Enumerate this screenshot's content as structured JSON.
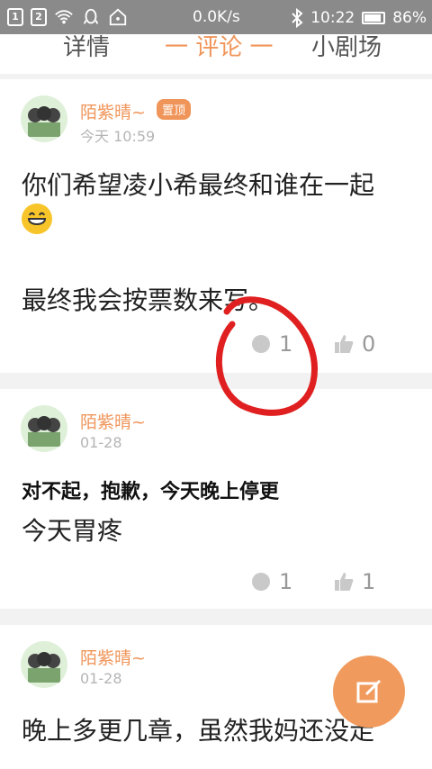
{
  "status_bar": {
    "sim1": "1",
    "sim2": "2",
    "speed": "0.0K/s",
    "time": "10:22",
    "battery": "86%"
  },
  "tabs": [
    {
      "label": "详情"
    },
    {
      "label": "一 评论 一"
    },
    {
      "label": "小剧场"
    }
  ],
  "posts": [
    {
      "author": "陌紫晴~",
      "badge": "置顶",
      "time": "今天 10:59",
      "line1": "你们希望凌小希最终和谁在一起",
      "line2": "最终我会按票数来写。",
      "comments": "1",
      "likes": "0"
    },
    {
      "author": "陌紫晴~",
      "time": "01-28",
      "bold_line": "对不起，抱歉，今天晚上停更",
      "line1": "今天胃疼",
      "comments": "1",
      "likes": "1"
    },
    {
      "author": "陌紫晴~",
      "time": "01-28",
      "line1": "晚上多更几章，虽然我妈还没走"
    }
  ],
  "colors": {
    "accent": "#f0955a",
    "annotation": "#e02020"
  },
  "icons": {
    "comment": "comment-icon",
    "like": "thumbs-up-icon",
    "compose": "edit-icon"
  }
}
